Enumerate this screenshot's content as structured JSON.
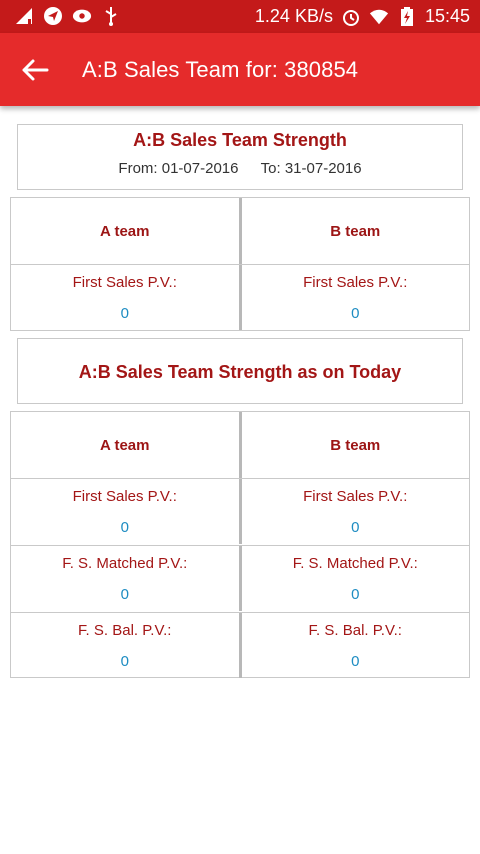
{
  "status_bar": {
    "speed": "1.24 KB/s",
    "time": "15:45"
  },
  "app_bar": {
    "title": "A:B Sales Team for: 380854"
  },
  "section1": {
    "title": "A:B Sales Team Strength",
    "from": "From: 01-07-2016",
    "to": "To: 31-07-2016",
    "headers": [
      "A team",
      "B team"
    ],
    "rows": [
      {
        "label": "First Sales P.V.:",
        "a": "0",
        "b": "0"
      }
    ]
  },
  "section2": {
    "title": "A:B Sales Team Strength as on Today",
    "headers": [
      "A team",
      "B team"
    ],
    "rows": [
      {
        "label": "First Sales P.V.:",
        "a": "0",
        "b": "0"
      },
      {
        "label": "F. S. Matched P.V.:",
        "a": "0",
        "b": "0"
      },
      {
        "label": "F. S. Bal. P.V.:",
        "a": "0",
        "b": "0"
      }
    ]
  },
  "colors": {
    "status_bar": "#c41a1a",
    "app_bar": "#e52b2b",
    "label": "#a31616",
    "value": "#1d8cc2"
  }
}
